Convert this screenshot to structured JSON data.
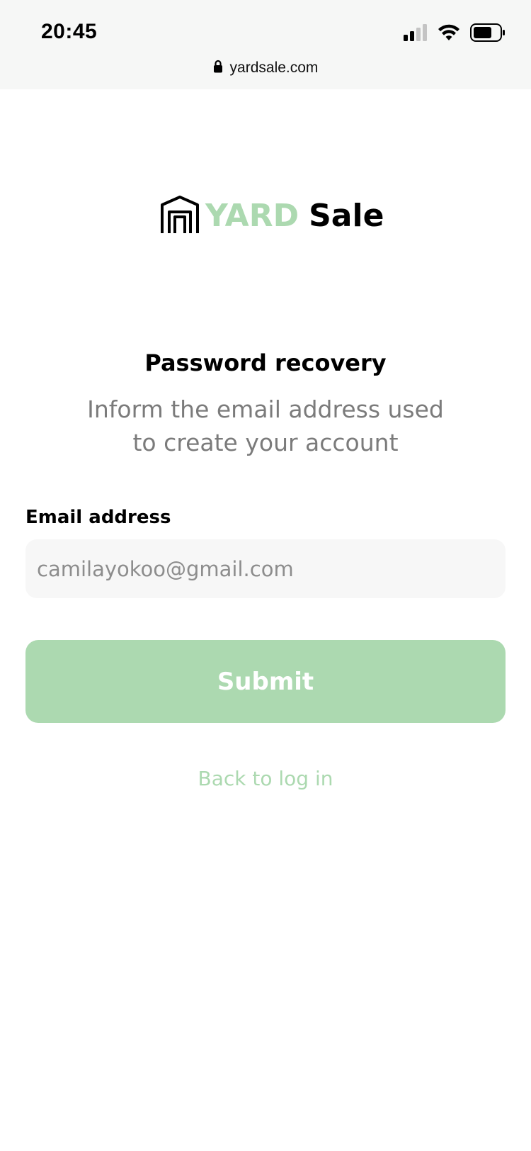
{
  "status_bar": {
    "time": "20:45",
    "icons": [
      "signal-icon",
      "wifi-icon",
      "battery-icon"
    ]
  },
  "browser": {
    "url": "yardsale.com",
    "lock_icon": "lock-icon"
  },
  "logo": {
    "icon": "house-icon",
    "word_yard": "YARD",
    "word_sale": "Sale"
  },
  "recovery": {
    "title": "Password recovery",
    "subtitle_line1": "Inform the email address used",
    "subtitle_line2": "to create your account"
  },
  "form": {
    "email_label": "Email address",
    "email_placeholder": "camilayokoo@gmail.com",
    "email_value": "",
    "submit_label": "Submit",
    "back_label": "Back to log in"
  },
  "colors": {
    "accent": "#acd9b0",
    "input_bg": "#f7f7f7",
    "subtitle_text": "#7b7b7b",
    "browser_bar": "#f6f7f6"
  }
}
